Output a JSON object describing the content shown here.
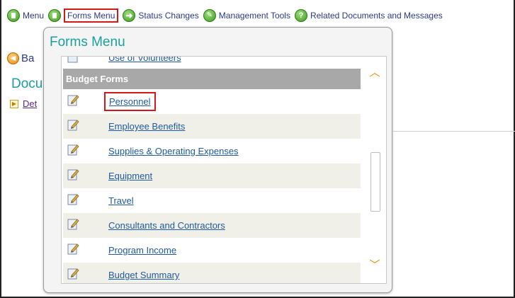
{
  "nav": {
    "items": [
      {
        "label": "Menu",
        "icon": "menu-icon"
      },
      {
        "label": "Forms Menu",
        "icon": "forms-menu-icon"
      },
      {
        "label": "Status Changes",
        "icon": "arrow-right-icon"
      },
      {
        "label": "Management Tools",
        "icon": "tools-icon"
      },
      {
        "label": "Related Documents and Messages",
        "icon": "related-docs-icon"
      }
    ]
  },
  "page": {
    "back_label": "Ba",
    "doc_title": "Docu",
    "detail_link": "Det"
  },
  "popup": {
    "title": "Forms Menu",
    "cut_item": "Use of Volunteers",
    "section_header": "Budget Forms",
    "items": [
      {
        "label": "Personnel"
      },
      {
        "label": "Employee Benefits"
      },
      {
        "label": "Supplies & Operating Expenses"
      },
      {
        "label": "Equipment"
      },
      {
        "label": "Travel"
      },
      {
        "label": "Consultants and Contractors"
      },
      {
        "label": "Program Income"
      },
      {
        "label": "Budget Summary"
      }
    ]
  },
  "colors": {
    "highlight": "#d11a1a",
    "accent_teal": "#1aa0a0",
    "link_blue": "#1f5aa0",
    "icon_green": "#3c9a1e",
    "scroll_orange": "#f08a00"
  }
}
